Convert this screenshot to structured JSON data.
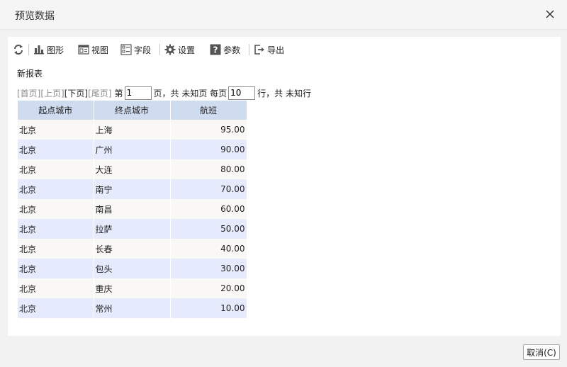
{
  "dialog": {
    "title": "预览数据",
    "close_icon": "close-icon",
    "cancel_label": "取消(C)"
  },
  "toolbar": {
    "refresh_icon": "refresh-icon",
    "chart": {
      "label": "图形",
      "icon": "bar-chart-icon"
    },
    "view": {
      "label": "视图",
      "icon": "view-icon"
    },
    "fields": {
      "label": "字段",
      "icon": "fields-icon"
    },
    "settings": {
      "label": "设置",
      "icon": "gear-icon"
    },
    "params": {
      "label": "参数",
      "icon": "question-icon"
    },
    "export": {
      "label": "导出",
      "icon": "export-icon"
    }
  },
  "report": {
    "title": "新报表"
  },
  "pager": {
    "first": "[首页]",
    "prev": "[上页]",
    "next": "[下页]",
    "last": "[尾页]",
    "page_prefix": "第",
    "page_value": "1",
    "page_suffix": "页，共 未知页 每页",
    "rows_value": "10",
    "rows_suffix": "行，共 未知行"
  },
  "table": {
    "columns": [
      "起点城市",
      "终点城市",
      "航班"
    ],
    "rows": [
      [
        "北京",
        "上海",
        "95.00"
      ],
      [
        "北京",
        "广州",
        "90.00"
      ],
      [
        "北京",
        "大连",
        "80.00"
      ],
      [
        "北京",
        "南宁",
        "70.00"
      ],
      [
        "北京",
        "南昌",
        "60.00"
      ],
      [
        "北京",
        "拉萨",
        "50.00"
      ],
      [
        "北京",
        "长春",
        "40.00"
      ],
      [
        "北京",
        "包头",
        "30.00"
      ],
      [
        "北京",
        "重庆",
        "20.00"
      ],
      [
        "北京",
        "常州",
        "10.00"
      ]
    ]
  },
  "colors": {
    "header_bg": "#cfdcef",
    "row_odd": "#f9f8f4",
    "row_even": "#e6eafd",
    "icon_gray": "#555555"
  }
}
